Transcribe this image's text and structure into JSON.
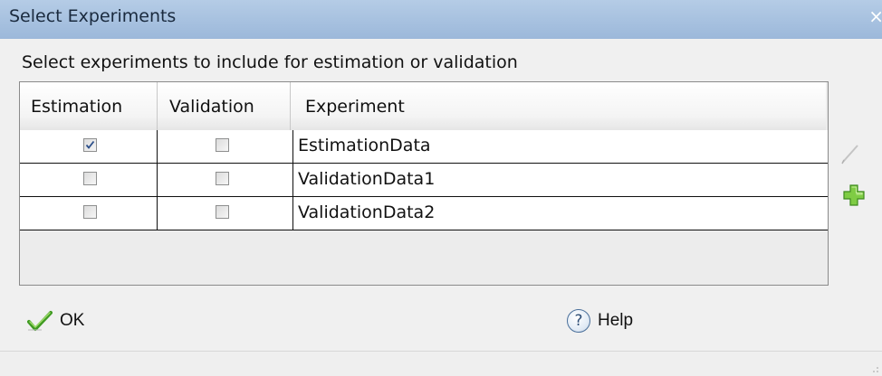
{
  "window": {
    "title": "Select Experiments",
    "close_glyph": "×"
  },
  "instruction": "Select experiments to include for estimation or validation",
  "table": {
    "columns": [
      "Estimation",
      "Validation",
      "Experiment"
    ],
    "rows": [
      {
        "estimation": true,
        "validation": false,
        "experiment": "EstimationData"
      },
      {
        "estimation": false,
        "validation": false,
        "experiment": "ValidationData1"
      },
      {
        "estimation": false,
        "validation": false,
        "experiment": "ValidationData2"
      }
    ]
  },
  "side_icons": [
    "edit-pencil-icon",
    "add-plus-icon"
  ],
  "buttons": {
    "ok": "OK",
    "help": "Help",
    "help_glyph": "?"
  },
  "colors": {
    "titlebar": "#a8c2e0",
    "add_icon": "#6bbf3a",
    "ok_check": "#4caa2a",
    "help_icon": "#4a6f9a"
  }
}
